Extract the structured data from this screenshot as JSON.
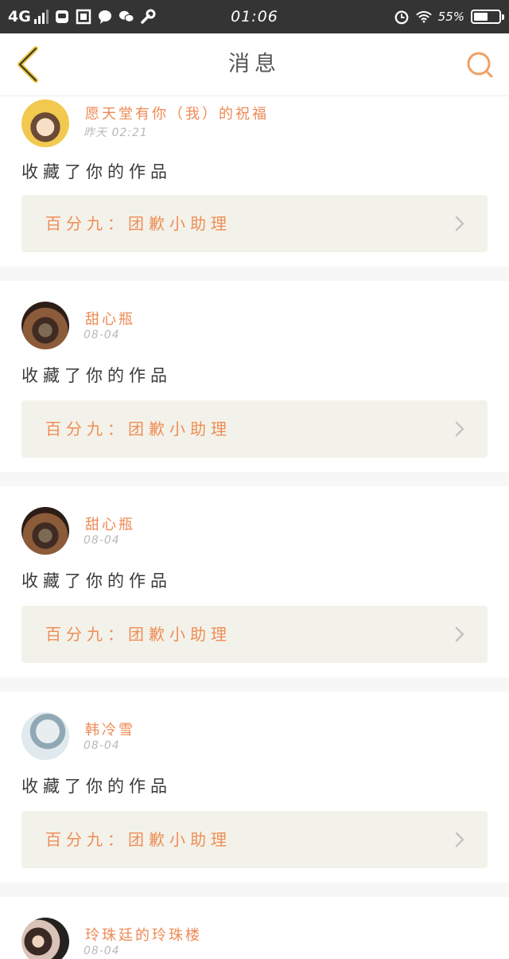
{
  "status_bar": {
    "network": "4G",
    "time": "01:06",
    "battery_text": "55%",
    "battery_level": 0.55
  },
  "navbar": {
    "title": "消息",
    "back_icon": "chevron-left-icon",
    "search_icon": "search-icon"
  },
  "colors": {
    "accent": "#ee8a55",
    "back_icon": "#e7c441",
    "card_bg": "#f3f2ea",
    "divider": "#f7f7f7"
  },
  "feed": [
    {
      "name": "愿天堂有你（我）的祝福",
      "time": "昨天 02:21",
      "message": "收藏了你的作品",
      "work_title": "百分九：团歉小助理"
    },
    {
      "name": "甜心瓶",
      "time": "08-04",
      "message": "收藏了你的作品",
      "work_title": "百分九：团歉小助理"
    },
    {
      "name": "甜心瓶",
      "time": "08-04",
      "message": "收藏了你的作品",
      "work_title": "百分九：团歉小助理"
    },
    {
      "name": "韩冷雪",
      "time": "08-04",
      "message": "收藏了你的作品",
      "work_title": "百分九：团歉小助理"
    },
    {
      "name": "玲珠廷的玲珠楼",
      "time": "08-04"
    }
  ]
}
